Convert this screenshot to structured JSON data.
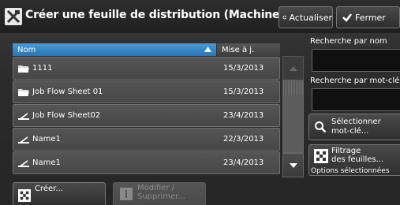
{
  "window": {
    "title": "Créer une feuille de distribution (Machine locale)",
    "title_icon": "tools-icon"
  },
  "toolbar": {
    "refresh_label": "Actualiser",
    "refresh_icon": "refresh-icon",
    "close_label": "Fermer",
    "close_icon": "checkmark-icon"
  },
  "list": {
    "columns": {
      "name": "Nom",
      "date": "Mise à j."
    },
    "sort": "ascending",
    "rows": [
      {
        "icon": "folder-icon",
        "name": "1111",
        "date": "15/3/2013"
      },
      {
        "icon": "folder-icon",
        "name": "Job Flow Sheet 01",
        "date": "15/3/2013"
      },
      {
        "icon": "sheet-icon",
        "name": "Job Flow Sheet02",
        "date": "23/4/2013"
      },
      {
        "icon": "sheet-icon",
        "name": "Name1",
        "date": "22/3/2013"
      },
      {
        "icon": "sheet-icon",
        "name": "Name1",
        "date": "23/4/2013"
      }
    ]
  },
  "side": {
    "search_name_label": "Recherche par nom",
    "search_name_value": "",
    "search_keyword_label": "Recherche par mot-clé",
    "search_keyword_value": "",
    "select_keyword_line1": "Sélectionner",
    "select_keyword_line2": "mot-clé...",
    "filter_line1": "Filtrage",
    "filter_line2": "des feuilles...",
    "filter_status": "Options sélectionnées"
  },
  "bottom": {
    "create_label": "Créer...",
    "modify_line1": "Modifier /",
    "modify_line2": "Supprimer..."
  },
  "colors": {
    "accent": "#2a74b8",
    "background": "#2b2b2b",
    "row": "#4e4e4e"
  }
}
